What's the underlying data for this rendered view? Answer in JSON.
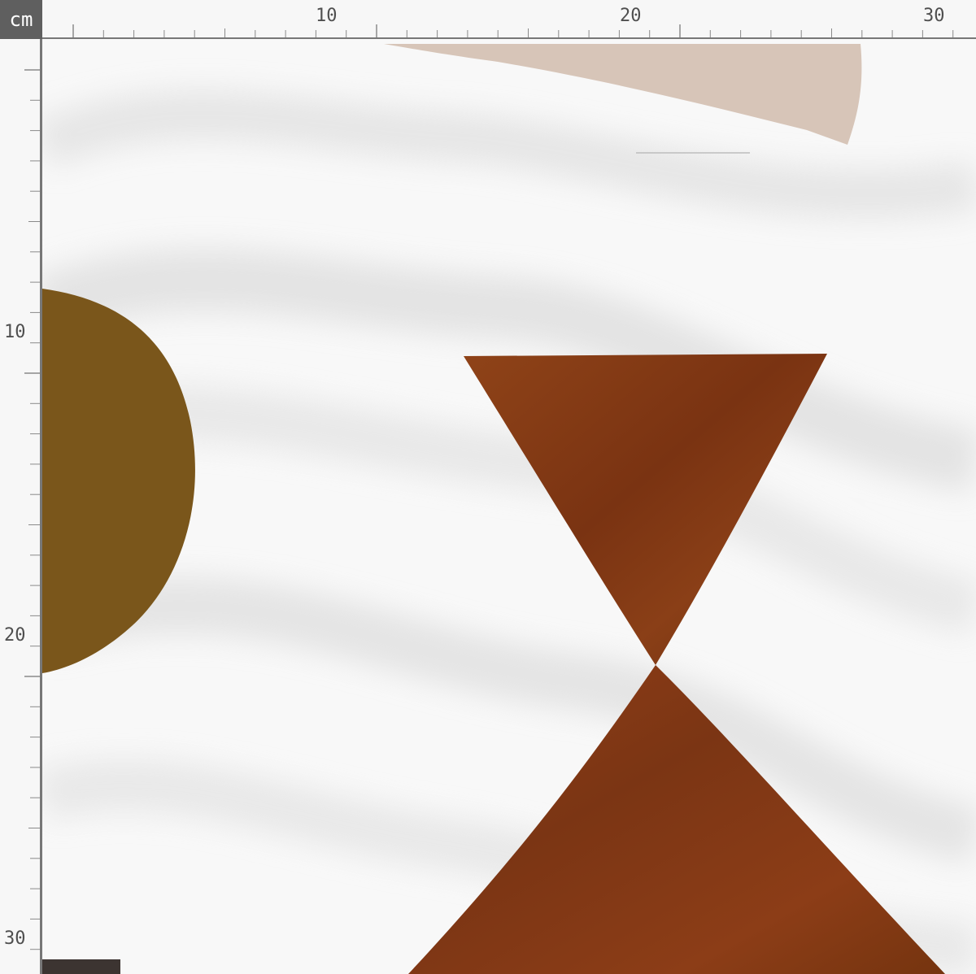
{
  "unit_label": "cm",
  "ruler": {
    "top_labels": [
      "10",
      "20",
      "30"
    ],
    "left_labels": [
      "10",
      "20",
      "30"
    ]
  },
  "pattern": {
    "background_color": "#f8f8f8",
    "shapes": [
      {
        "name": "pink-fan-shape",
        "color": "#d7c5b8"
      },
      {
        "name": "olive-half-circle",
        "color": "#7a561b"
      },
      {
        "name": "rust-hourglass-top",
        "color": "#8a3f17"
      },
      {
        "name": "rust-hourglass-bottom",
        "color": "#8a3f17"
      },
      {
        "name": "dark-rectangle",
        "color": "#3c3431"
      }
    ],
    "shadow_color": "#cfcfcf"
  }
}
